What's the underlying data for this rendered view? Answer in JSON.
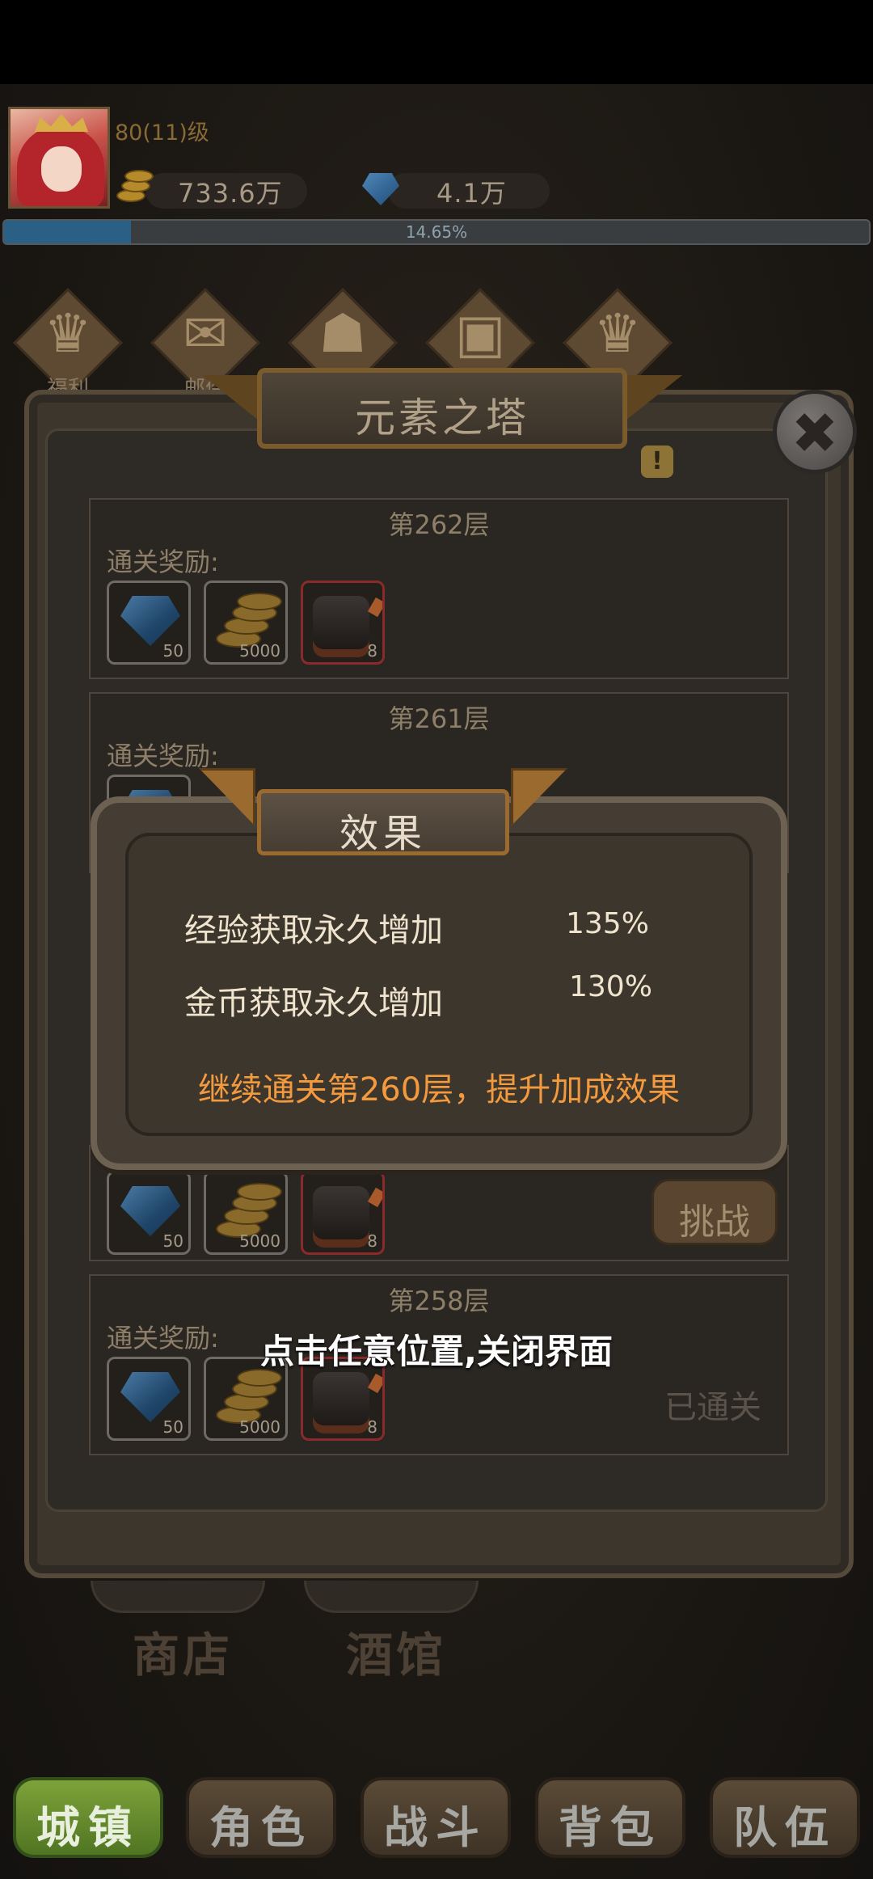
{
  "header": {
    "level_text": "80(11)级",
    "gold": "733.6万",
    "gems": "4.1万",
    "exp_percent_text": "14.65%",
    "exp_progress": 0.1465
  },
  "top_menu": [
    {
      "label": "福利",
      "icon": "trophy-icon"
    },
    {
      "label": "邮件",
      "icon": "envelope-icon"
    },
    {
      "label": "",
      "icon": "map-icon"
    },
    {
      "label": "",
      "icon": "chest-icon"
    },
    {
      "label": "",
      "icon": "trophy-icon"
    }
  ],
  "tower_panel": {
    "title": "元素之塔",
    "info_label": "!",
    "close_label": "✖",
    "floors": [
      {
        "name": "第262层",
        "reward_label": "通关奖励:",
        "rewards": [
          {
            "type": "gem",
            "qty": "50"
          },
          {
            "type": "coin",
            "qty": "5000"
          },
          {
            "type": "ore",
            "qty": "8"
          }
        ]
      },
      {
        "name": "第261层",
        "reward_label": "通关奖励:"
      },
      {
        "status": "挑战",
        "rewards": [
          {
            "type": "gem",
            "qty": "50"
          },
          {
            "type": "coin",
            "qty": "5000"
          },
          {
            "type": "ore",
            "qty": "8"
          }
        ]
      },
      {
        "name": "第258层",
        "reward_label": "通关奖励:",
        "status": "已通关",
        "rewards": [
          {
            "type": "gem",
            "qty": "50"
          },
          {
            "type": "coin",
            "qty": "5000"
          },
          {
            "type": "ore",
            "qty": "8"
          }
        ]
      }
    ]
  },
  "effect_popup": {
    "title": "效果",
    "rows": [
      {
        "label": "经验获取永久增加",
        "value": "135%"
      },
      {
        "label": "金币获取永久增加",
        "value": "130%"
      }
    ],
    "hint": "继续通关第260层，提升加成效果"
  },
  "close_tip": "点击任意位置,关闭界面",
  "town": {
    "shop": "商店",
    "tavern": "酒馆"
  },
  "bottom_nav": [
    {
      "label": "城镇",
      "active": true
    },
    {
      "label": "角色",
      "active": false
    },
    {
      "label": "战斗",
      "active": false
    },
    {
      "label": "背包",
      "active": false
    },
    {
      "label": "队伍",
      "active": false
    }
  ],
  "colors": {
    "accent_orange": "#f39a3f",
    "nav_active": "#6e9530",
    "exp_fill": "#2a5f86"
  }
}
